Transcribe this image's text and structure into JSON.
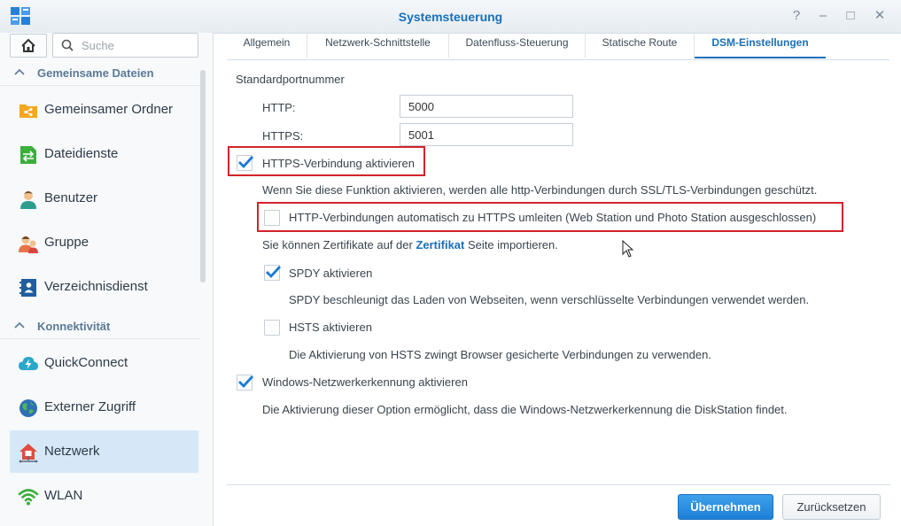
{
  "window": {
    "title": "Systemsteuerung",
    "controls": {
      "help": "?",
      "minimize": "–",
      "maximize": "□",
      "close": "✕"
    }
  },
  "sidebar": {
    "search_placeholder": "Suche",
    "sections": [
      {
        "label": "Gemeinsame Dateien",
        "items": [
          {
            "label": "Gemeinsamer Ordner",
            "icon": "shared-folder-icon"
          },
          {
            "label": "Dateidienste",
            "icon": "file-services-icon"
          },
          {
            "label": "Benutzer",
            "icon": "user-icon"
          },
          {
            "label": "Gruppe",
            "icon": "group-icon"
          },
          {
            "label": "Verzeichnisdienst",
            "icon": "directory-icon"
          }
        ]
      },
      {
        "label": "Konnektivität",
        "items": [
          {
            "label": "QuickConnect",
            "icon": "quickconnect-icon"
          },
          {
            "label": "Externer Zugriff",
            "icon": "external-access-icon"
          },
          {
            "label": "Netzwerk",
            "icon": "network-icon",
            "active": true
          },
          {
            "label": "WLAN",
            "icon": "wifi-icon"
          }
        ]
      }
    ]
  },
  "tabs": [
    {
      "label": "Allgemein"
    },
    {
      "label": "Netzwerk-Schnittstelle"
    },
    {
      "label": "Datenfluss-Steuerung"
    },
    {
      "label": "Statische Route"
    },
    {
      "label": "DSM-Einstellungen",
      "active": true
    }
  ],
  "settings": {
    "port_heading": "Standardportnummer",
    "http_label": "HTTP:",
    "http_value": "5000",
    "https_label": "HTTPS:",
    "https_value": "5001",
    "https_enable": {
      "label": "HTTPS-Verbindung aktivieren",
      "checked": true
    },
    "https_desc": "Wenn Sie diese Funktion aktivieren, werden alle http-Verbindungen durch SSL/TLS-Verbindungen geschützt.",
    "redirect": {
      "label": "HTTP-Verbindungen automatisch zu HTTPS umleiten (Web Station und Photo Station ausgeschlossen)",
      "checked": false
    },
    "cert_prefix": "Sie können Zertifikate auf der",
    "cert_link": "Zertifikat",
    "cert_suffix": "Seite importieren.",
    "spdy": {
      "label": "SPDY aktivieren",
      "checked": true
    },
    "spdy_desc": "SPDY beschleunigt das Laden von Webseiten, wenn verschlüsselte Verbindungen verwendet werden.",
    "hsts": {
      "label": "HSTS aktivieren",
      "checked": false
    },
    "hsts_desc": "Die Aktivierung von HSTS zwingt Browser gesicherte Verbindungen zu verwenden.",
    "netbios": {
      "label": "Windows-Netzwerkerkennung aktivieren",
      "checked": true
    },
    "netbios_desc": "Die Aktivierung dieser Option ermöglicht, dass die Windows-Netzwerkerkennung die DiskStation findet."
  },
  "footer": {
    "apply": "Übernehmen",
    "reset": "Zurücksetzen"
  }
}
